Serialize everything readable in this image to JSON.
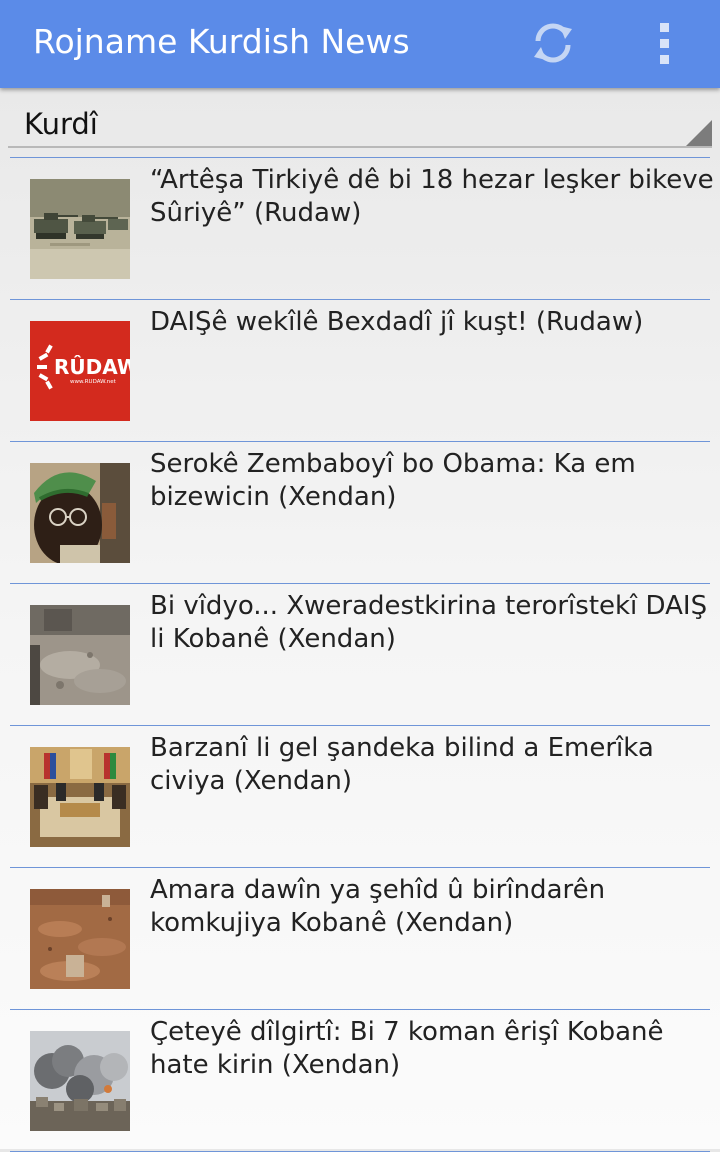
{
  "app": {
    "title": "Rojname Kurdish News"
  },
  "toolbar": {
    "refresh_icon": "refresh-icon",
    "overflow_icon": "overflow-menu-icon"
  },
  "language_selector": {
    "selected": "Kurdî"
  },
  "articles": [
    {
      "headline": "“Artêşa Tirkiyê dê bi 18 hezar leşker bikeve Sûriyê” (Rudaw)",
      "thumbnail": "tanks-photo"
    },
    {
      "headline": "DAIŞê wekîlê Bexdadî jî kuşt! (Rudaw)",
      "thumbnail": "rudaw-logo",
      "logo_text": "RÛDAW",
      "logo_url_text": "www.RUDAW.net"
    },
    {
      "headline": "Serokê Zembaboyî bo Obama: Ka em bizewicin (Xendan)",
      "thumbnail": "portrait-photo"
    },
    {
      "headline": "Bi vîdyo... Xweradestkirina terorîstekî DAIŞ li Kobanê (Xendan)",
      "thumbnail": "rubble-photo"
    },
    {
      "headline": "Barzanî li gel şandeka bilind a Emerîka civiya (Xendan)",
      "thumbnail": "meeting-room-photo"
    },
    {
      "headline": "Amara dawîn ya şehîd û birîndarên komkujiya Kobanê (Xendan)",
      "thumbnail": "graves-photo"
    },
    {
      "headline": "Çeteyê dîlgirtî: Bi 7 koman êrişî Kobanê hate kirin (Xendan)",
      "thumbnail": "smoke-city-photo"
    }
  ],
  "colors": {
    "action_bar": "#5b8be8",
    "divider": "#6f95d8",
    "rudaw_red": "#d32a1e"
  }
}
